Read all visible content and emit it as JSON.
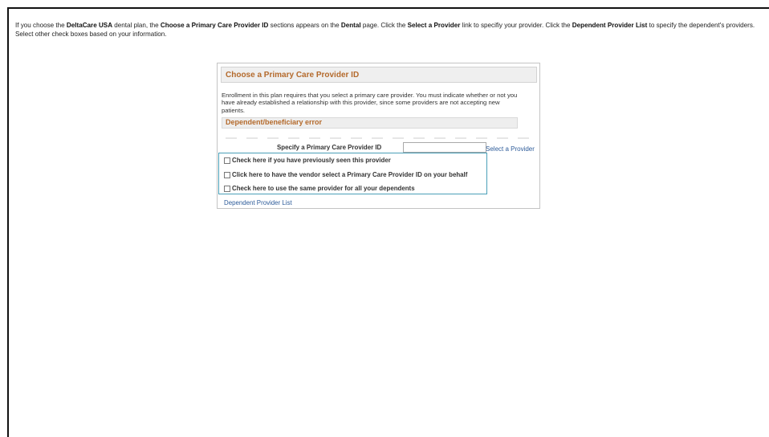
{
  "intro": {
    "p1": "If you choose the ",
    "b1": "DeltaCare USA",
    "p2": " dental plan, the ",
    "b2": "Choose a Primary Care Provider ID",
    "p3": " sections appears on the ",
    "b3": "Dental",
    "p4": " page. Click the ",
    "b4": "Select a Provider",
    "p5": " link to specifiy your provider. Click the ",
    "b5": "Dependent Provider List",
    "p6": " to specify the dependent's providers. Select other check boxes based on your information."
  },
  "panel": {
    "title": "Choose a Primary Care Provider ID",
    "description": "Enrollment in this plan requires that you select a primary care provider. You must indicate whether or not you have already established a relationship with this provider, since some providers are not accepting new patients.",
    "error_title": "Dependent/beneficiary error",
    "specify_label": "Specify a Primary Care Provider ID",
    "specify_value": "",
    "select_provider_link": "Select a Provider",
    "checks": [
      {
        "label": "Check here if you have previously seen this provider",
        "checked": false
      },
      {
        "label": "Click here to have the vendor select a Primary Care Provider ID on your behalf",
        "checked": false
      },
      {
        "label": "Check here to use the same provider for all your dependents",
        "checked": false
      }
    ],
    "dependent_link": "Dependent Provider List"
  },
  "colors": {
    "heading_accent": "#b46a2c",
    "link": "#2e5c9a",
    "highlight_border": "#4aa0b8"
  }
}
